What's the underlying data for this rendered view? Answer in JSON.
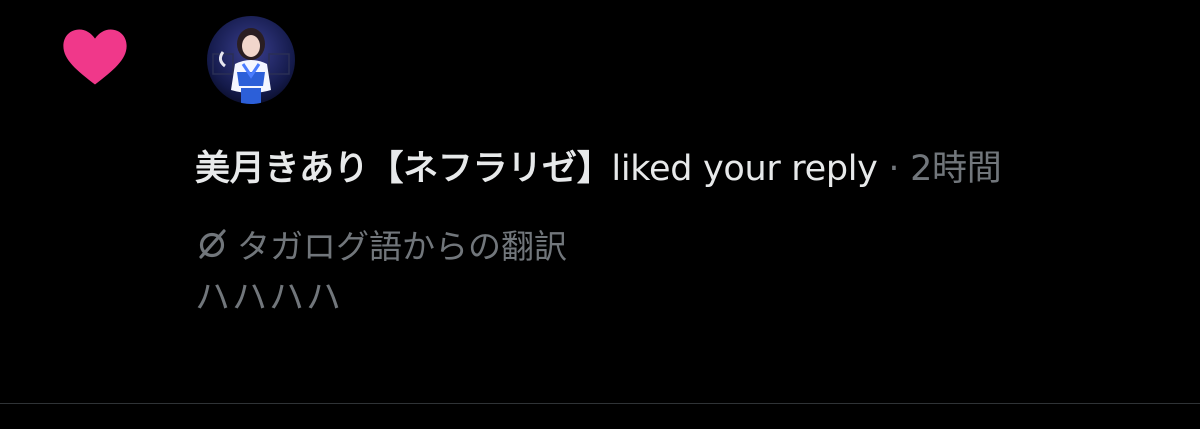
{
  "notification": {
    "icon": "heart-icon",
    "icon_color": "#f0388a",
    "avatar": "user-avatar",
    "user_name": "美月きあり【ネフラリゼ】",
    "action": "liked your reply",
    "separator": "·",
    "timestamp": "2時間",
    "translation": {
      "icon": "translate-icon",
      "label": "タガログ語からの翻訳"
    },
    "reply_text": "ハハハハ"
  },
  "colors": {
    "background": "#000000",
    "primary_text": "#e7e9ea",
    "secondary_text": "#71767b",
    "divider": "#2f3336"
  }
}
